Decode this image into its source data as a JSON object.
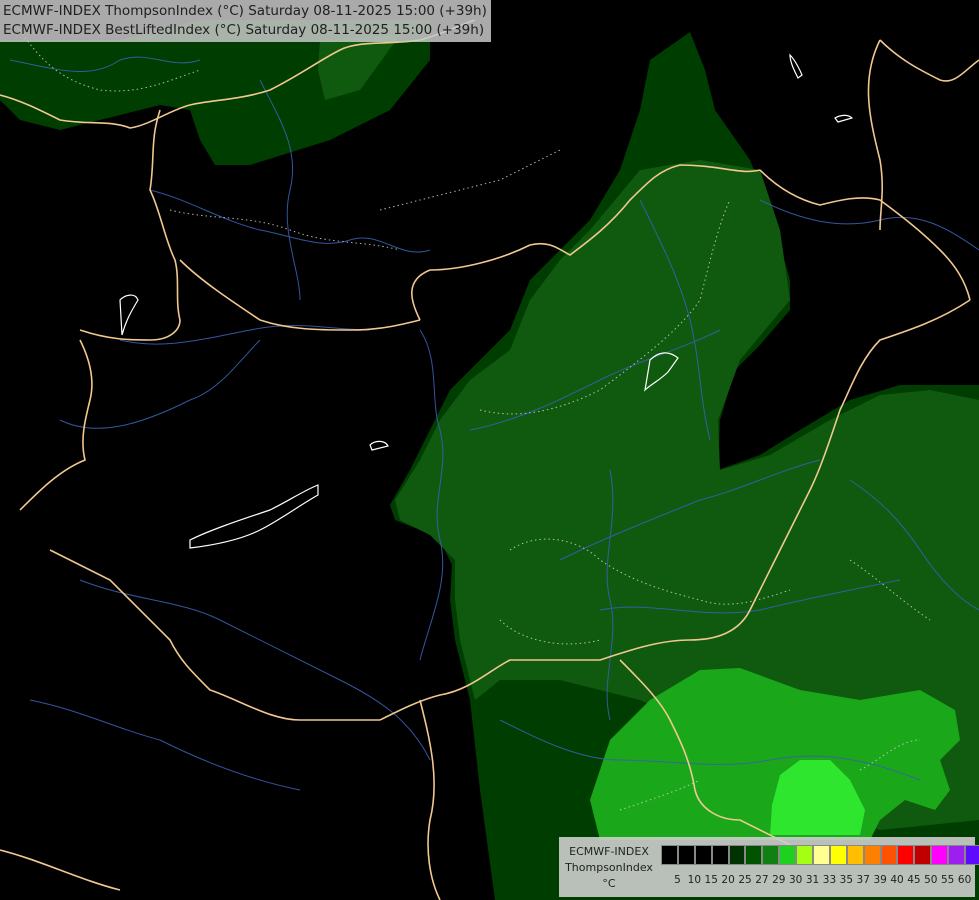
{
  "title": {
    "line1": "ECMWF-INDEX ThompsonIndex (°C) Saturday 08-11-2025 15:00 (+39h)",
    "line2": "ECMWF-INDEX BestLiftedIndex (°C) Saturday 08-11-2025 15:00 (+39h)"
  },
  "legend": {
    "line1": "ECMWF-INDEX",
    "line2": "ThompsonIndex",
    "line3": "°C",
    "colors": [
      "#000000",
      "#000000",
      "#000000",
      "#000000",
      "#003300",
      "#005400",
      "#127f12",
      "#1fd11f",
      "#a4ff14",
      "#ffff92",
      "#ffff00",
      "#ffbf00",
      "#ff8000",
      "#ff5200",
      "#ff0000",
      "#c00000",
      "#ff00ff",
      "#9d1ff0",
      "#5e0aff",
      "#0000ff"
    ],
    "ticks": [
      "5",
      "10",
      "15",
      "20",
      "25",
      "27",
      "29",
      "30",
      "31",
      "33",
      "35",
      "37",
      "39",
      "40",
      "45",
      "50",
      "55",
      "60"
    ]
  },
  "map": {
    "zone_colors": {
      "dark": "#003d00",
      "mid": "#0f5a0f",
      "bright": "#1aa81a",
      "brightest": "#2ee62e"
    }
  }
}
